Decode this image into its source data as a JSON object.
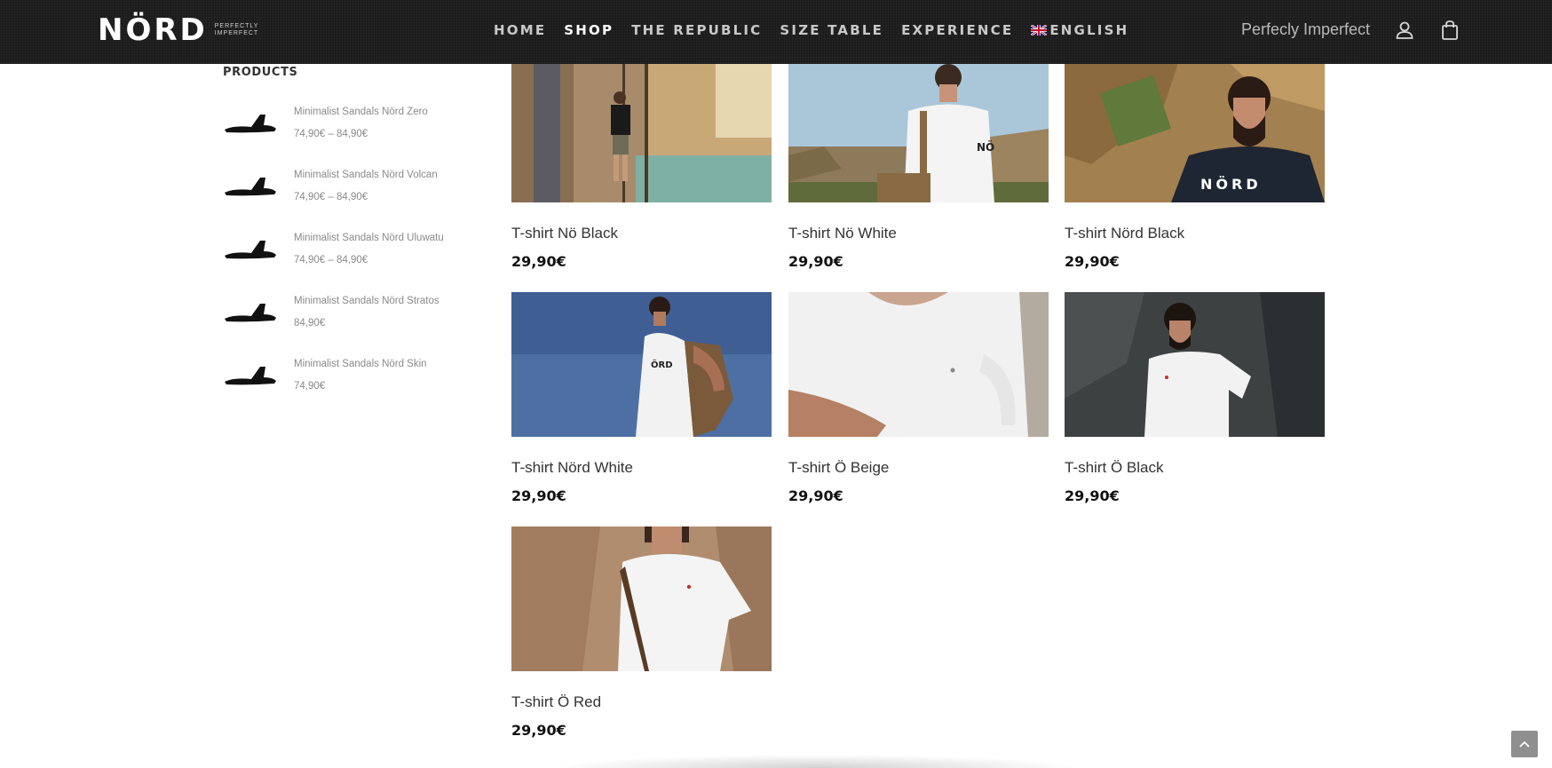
{
  "header": {
    "logo_text": "NÖRD",
    "logo_tagline_line1": "PERFECTLY",
    "logo_tagline_line2": "IMPERFECT",
    "nav": [
      {
        "label": "HOME",
        "active": false
      },
      {
        "label": "SHOP",
        "active": true
      },
      {
        "label": "THE REPUBLIC",
        "active": false
      },
      {
        "label": "SIZE TABLE",
        "active": false
      },
      {
        "label": "EXPERIENCE",
        "active": false
      }
    ],
    "language_label": "ENGLISH",
    "language_icon": "uk-flag-icon",
    "tagline": "Perfecly Imperfect",
    "account_icon": "user-icon",
    "cart_icon": "shopping-bag-icon"
  },
  "sidebar": {
    "heading": "PRODUCTS",
    "items": [
      {
        "name": "Minimalist Sandals Nörd Zero",
        "price": "74,90€ – 84,90€"
      },
      {
        "name": "Minimalist Sandals Nörd Volcan",
        "price": "74,90€ – 84,90€"
      },
      {
        "name": "Minimalist Sandals Nörd Uluwatu",
        "price": "74,90€ – 84,90€"
      },
      {
        "name": "Minimalist Sandals Nörd Stratos",
        "price": "84,90€"
      },
      {
        "name": "Minimalist Sandals Nörd Skin",
        "price": "74,90€"
      }
    ]
  },
  "products": [
    {
      "title": "T-shirt Nö Black",
      "price": "29,90€"
    },
    {
      "title": "T-shirt Nö White",
      "price": "29,90€"
    },
    {
      "title": "T-shirt Nörd Black",
      "price": "29,90€"
    },
    {
      "title": "T-shirt Nörd White",
      "price": "29,90€"
    },
    {
      "title": "T-shirt Ö Beige",
      "price": "29,90€"
    },
    {
      "title": "T-shirt Ö Black",
      "price": "29,90€"
    },
    {
      "title": "T-shirt Ö Red",
      "price": "29,90€"
    }
  ],
  "colors": {
    "header_bg": "#1b1b1b",
    "nav_inactive": "#c9c9c9",
    "nav_active": "#ffffff",
    "text_muted": "#8a8a8a",
    "price_text": "#111111"
  },
  "scroll_top_icon": "chevron-up-icon"
}
